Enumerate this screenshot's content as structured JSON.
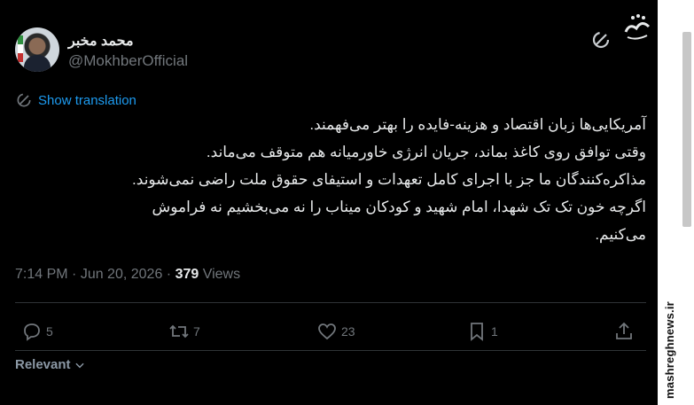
{
  "author": {
    "display_name": "محمد مخبر",
    "handle": "@MokhberOfficial"
  },
  "translate": {
    "label": "Show translation",
    "icon": "globe-icon"
  },
  "tweet": {
    "lines": [
      "آمریکایی‌ها زبان اقتصاد و هزینه-فایده را بهتر می‌فهمند.",
      "وقتی توافق روی کاغذ بماند، جریان انرژی خاورمیانه هم متوقف می‌ماند.",
      "مذاکره‌کنندگان ما جز با اجرای کامل تعهدات و استیفای حقوق ملت راضی نمی‌شوند.",
      "اگرچه خون تک تک شهدا، امام شهید و کودکان میناب را نه می‌بخشیم نه فراموش",
      "می‌کنیم."
    ]
  },
  "meta": {
    "time": "7:14 PM",
    "separator": " · ",
    "date": "Jun 20, 2026",
    "views_count": "379",
    "views_label": "Views"
  },
  "actions": {
    "reply_count": "5",
    "repost_count": "7",
    "like_count": "23",
    "bookmark_count": "1"
  },
  "replies_filter": {
    "label": "Relevant"
  },
  "watermark": {
    "logo_text": "مشرق",
    "side_text": "mashreghnews.ir"
  },
  "colors": {
    "background": "#000000",
    "text": "#e7e9ea",
    "muted": "#71767b",
    "link": "#1d9bf0",
    "divider": "#2f3336"
  }
}
